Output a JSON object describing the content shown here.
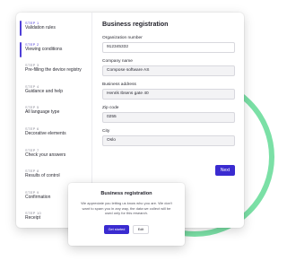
{
  "steps": [
    {
      "num": "STEP 1",
      "title": "Validation rules",
      "active": true
    },
    {
      "num": "STEP 2",
      "title": "Viewing conditions",
      "active": true
    },
    {
      "num": "STEP 3",
      "title": "Pre-filling the device registry",
      "active": false
    },
    {
      "num": "STEP 4",
      "title": "Guidance and help",
      "active": false
    },
    {
      "num": "STEP 5",
      "title": "All language type",
      "active": false
    },
    {
      "num": "STEP 6",
      "title": "Decorative elements",
      "active": false
    },
    {
      "num": "STEP 7",
      "title": "Check your answers",
      "active": false
    },
    {
      "num": "STEP 8",
      "title": "Results of control",
      "active": false
    },
    {
      "num": "STEP 9",
      "title": "Confirmation",
      "active": false
    },
    {
      "num": "STEP 10",
      "title": "Receipt",
      "active": false
    }
  ],
  "form": {
    "title": "Business registration",
    "fields": [
      {
        "label": "Organization number",
        "value": "912345332"
      },
      {
        "label": "Company name",
        "value": "Compose software AS"
      },
      {
        "label": "Business address",
        "value": "Henrik Ibsens gate 40"
      },
      {
        "label": "Zip code",
        "value": "0255"
      },
      {
        "label": "City",
        "value": "Oslo"
      }
    ],
    "next_label": "Next"
  },
  "modal": {
    "title": "Business registration",
    "body": "We appreciate you letting us know who you are. We don't want to spam you in any way, the data we collect will be used only for this research.",
    "primary_label": "Get started",
    "secondary_label": "Edit"
  },
  "colors": {
    "accent": "#3a2bd0",
    "ring": "#7be0a6"
  }
}
